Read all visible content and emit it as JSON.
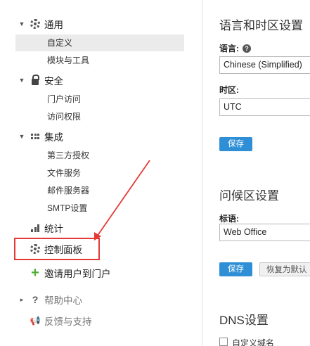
{
  "sidebar": {
    "general": {
      "label": "通用",
      "icon": "gear-icon",
      "items": [
        "自定义",
        "模块与工具"
      ]
    },
    "security": {
      "label": "安全",
      "icon": "lock-icon",
      "items": [
        "门户访问",
        "访问权限"
      ]
    },
    "integration": {
      "label": "集成",
      "icon": "grid-icon",
      "items": [
        "第三方授权",
        "文件服务",
        "邮件服务器",
        "SMTP设置"
      ]
    },
    "statistics": {
      "label": "统计",
      "icon": "bar-chart-icon"
    },
    "control_panel": {
      "label": "控制面板",
      "icon": "gear-icon"
    },
    "invite": {
      "label": "邀请用户到门户",
      "icon": "plus-icon"
    },
    "help": {
      "label": "帮助中心",
      "icon": "question-icon"
    },
    "feedback": {
      "label": "反馈与支持",
      "icon": "megaphone-icon"
    }
  },
  "main": {
    "language_section": {
      "title": "语言和时区设置",
      "language_label": "语言:",
      "language_value": "Chinese (Simplified)",
      "timezone_label": "时区:",
      "timezone_value": "UTC",
      "save_label": "保存"
    },
    "welcome_section": {
      "title": "问候区设置",
      "heading_label": "标语:",
      "heading_value": "Web Office",
      "save_label": "保存",
      "restore_label": "恢复为默认"
    },
    "dns_section": {
      "title": "DNS设置",
      "custom_domain_label": "自定义域名"
    }
  },
  "colors": {
    "accent": "#2f8fd6",
    "highlight_box": "#e53935",
    "plus_green": "#4caf2e"
  }
}
